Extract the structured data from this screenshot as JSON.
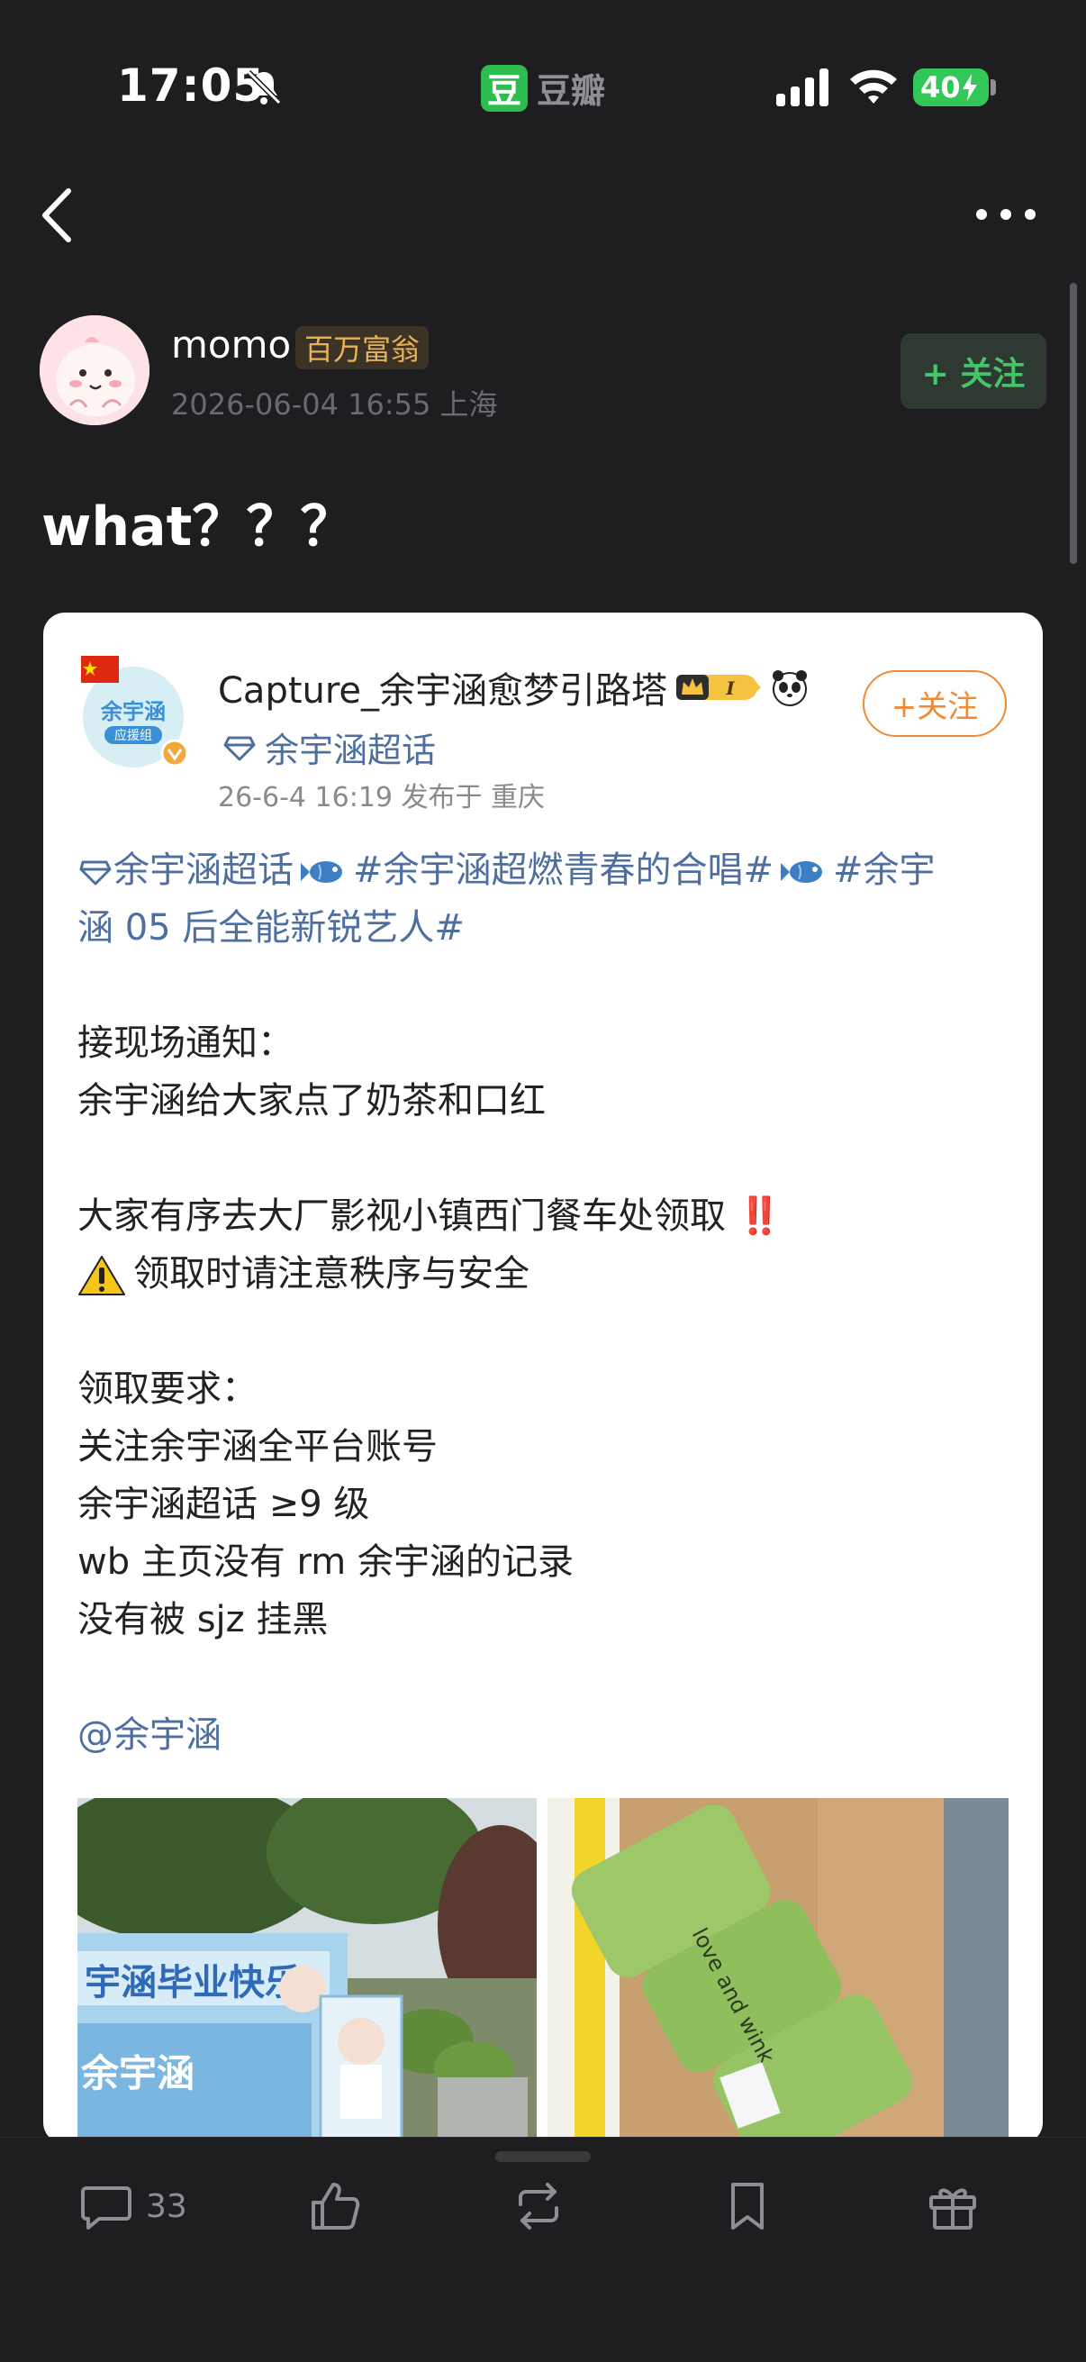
{
  "status_bar": {
    "time": "17:05",
    "app_name": "豆瓣",
    "app_logo_char": "豆",
    "battery": "40"
  },
  "author": {
    "name": "momo",
    "badge": "百万富翁",
    "meta": "2026-06-04 16:55  上海",
    "follow_label": "+ 关注"
  },
  "post": {
    "title": "what？？？"
  },
  "card": {
    "author": "Capture_余宇涵愈梦引路塔",
    "topic": "余宇涵超话",
    "meta": "26-6-4 16:19  发布于 重庆",
    "follow_label": "+关注",
    "avatar_text": "余宇涵",
    "avatar_sub": "应援组",
    "line1_tag1": "余宇涵超话",
    "line1_tag2": "#余宇涵超燃青春的合唱#",
    "line1_tag3": "#余宇",
    "line2": "涵 05 后全能新锐艺人#",
    "p1": "接现场通知：",
    "p2": "余宇涵给大家点了奶茶和口红",
    "p3": "大家有序去大厂影视小镇西门餐车处领取",
    "p3_mark": "‼️",
    "p4": "领取时请注意秩序与安全",
    "p5": "领取要求：",
    "p6": " 关注余宇涵全平台账号",
    "p7": " 余宇涵超话 ≥9 级",
    "p8": " wb 主页没有 rm 余宇涵的记录",
    "p9": " 没有被 sjz 挂黑",
    "mention": "@余宇涵",
    "photo_left_banner": "宇涵毕业快乐",
    "photo_right_text": "love and wink"
  },
  "bottom_bar": {
    "comments_count": "33"
  }
}
